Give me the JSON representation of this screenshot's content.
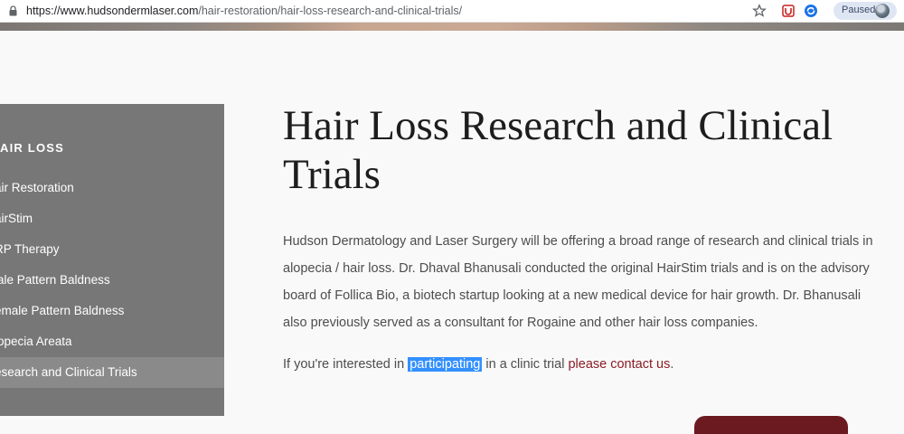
{
  "browser": {
    "url_domain": "https://www.hudsondermlaser.com",
    "url_path": "/hair-restoration/hair-loss-research-and-clinical-trials/",
    "paused_label": "Paused"
  },
  "sidebar": {
    "title": "AIR LOSS",
    "items": [
      {
        "label": "air Restoration"
      },
      {
        "label": "airStim"
      },
      {
        "label": "RP Therapy"
      },
      {
        "label": "lale Pattern Baldness"
      },
      {
        "label": "emale Pattern Baldness"
      },
      {
        "label": "lopecia Areata"
      },
      {
        "label": "esearch and Clinical Trials"
      }
    ]
  },
  "main": {
    "title": "Hair Loss Research and Clinical Trials",
    "paragraph": "Hudson Dermatology and Laser Surgery will be offering a broad range of research and clinical trials in alopecia / hair loss. Dr. Dhaval Bhanusali conducted the original HairStim trials and is on the advisory board of Follica Bio, a biotech startup looking at a new medical device for hair growth. Dr. Bhanusali also previously served as a consultant for Rogaine and other hair loss companies.",
    "cta_prefix": "If you're interested in ",
    "cta_highlight": "participating",
    "cta_middle": " in a clinic trial ",
    "cta_link": "please contact us",
    "cta_suffix": "."
  },
  "colors": {
    "sidebar_bg": "#777777",
    "sidebar_active_bg": "#8a8a8a",
    "link": "#8b1c25",
    "selection": "#3390ff"
  }
}
